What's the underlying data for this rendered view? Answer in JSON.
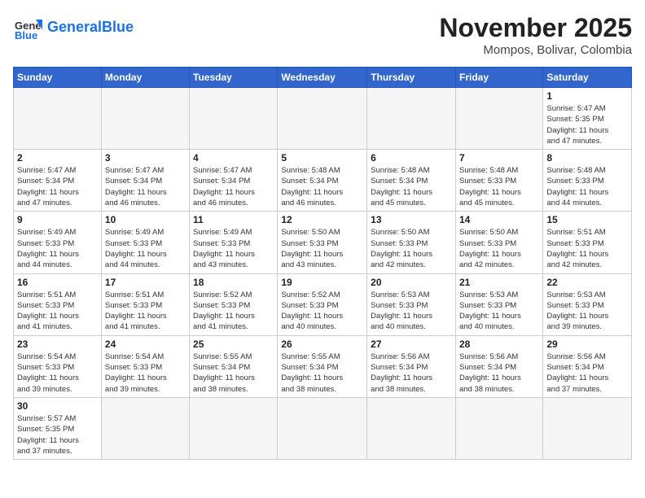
{
  "header": {
    "logo_text_general": "General",
    "logo_text_blue": "Blue",
    "month_year": "November 2025",
    "location": "Mompos, Bolivar, Colombia"
  },
  "weekdays": [
    "Sunday",
    "Monday",
    "Tuesday",
    "Wednesday",
    "Thursday",
    "Friday",
    "Saturday"
  ],
  "weeks": [
    [
      {
        "day": "",
        "info": ""
      },
      {
        "day": "",
        "info": ""
      },
      {
        "day": "",
        "info": ""
      },
      {
        "day": "",
        "info": ""
      },
      {
        "day": "",
        "info": ""
      },
      {
        "day": "",
        "info": ""
      },
      {
        "day": "1",
        "info": "Sunrise: 5:47 AM\nSunset: 5:35 PM\nDaylight: 11 hours\nand 47 minutes."
      }
    ],
    [
      {
        "day": "2",
        "info": "Sunrise: 5:47 AM\nSunset: 5:34 PM\nDaylight: 11 hours\nand 47 minutes."
      },
      {
        "day": "3",
        "info": "Sunrise: 5:47 AM\nSunset: 5:34 PM\nDaylight: 11 hours\nand 46 minutes."
      },
      {
        "day": "4",
        "info": "Sunrise: 5:47 AM\nSunset: 5:34 PM\nDaylight: 11 hours\nand 46 minutes."
      },
      {
        "day": "5",
        "info": "Sunrise: 5:48 AM\nSunset: 5:34 PM\nDaylight: 11 hours\nand 46 minutes."
      },
      {
        "day": "6",
        "info": "Sunrise: 5:48 AM\nSunset: 5:34 PM\nDaylight: 11 hours\nand 45 minutes."
      },
      {
        "day": "7",
        "info": "Sunrise: 5:48 AM\nSunset: 5:33 PM\nDaylight: 11 hours\nand 45 minutes."
      },
      {
        "day": "8",
        "info": "Sunrise: 5:48 AM\nSunset: 5:33 PM\nDaylight: 11 hours\nand 44 minutes."
      }
    ],
    [
      {
        "day": "9",
        "info": "Sunrise: 5:49 AM\nSunset: 5:33 PM\nDaylight: 11 hours\nand 44 minutes."
      },
      {
        "day": "10",
        "info": "Sunrise: 5:49 AM\nSunset: 5:33 PM\nDaylight: 11 hours\nand 44 minutes."
      },
      {
        "day": "11",
        "info": "Sunrise: 5:49 AM\nSunset: 5:33 PM\nDaylight: 11 hours\nand 43 minutes."
      },
      {
        "day": "12",
        "info": "Sunrise: 5:50 AM\nSunset: 5:33 PM\nDaylight: 11 hours\nand 43 minutes."
      },
      {
        "day": "13",
        "info": "Sunrise: 5:50 AM\nSunset: 5:33 PM\nDaylight: 11 hours\nand 42 minutes."
      },
      {
        "day": "14",
        "info": "Sunrise: 5:50 AM\nSunset: 5:33 PM\nDaylight: 11 hours\nand 42 minutes."
      },
      {
        "day": "15",
        "info": "Sunrise: 5:51 AM\nSunset: 5:33 PM\nDaylight: 11 hours\nand 42 minutes."
      }
    ],
    [
      {
        "day": "16",
        "info": "Sunrise: 5:51 AM\nSunset: 5:33 PM\nDaylight: 11 hours\nand 41 minutes."
      },
      {
        "day": "17",
        "info": "Sunrise: 5:51 AM\nSunset: 5:33 PM\nDaylight: 11 hours\nand 41 minutes."
      },
      {
        "day": "18",
        "info": "Sunrise: 5:52 AM\nSunset: 5:33 PM\nDaylight: 11 hours\nand 41 minutes."
      },
      {
        "day": "19",
        "info": "Sunrise: 5:52 AM\nSunset: 5:33 PM\nDaylight: 11 hours\nand 40 minutes."
      },
      {
        "day": "20",
        "info": "Sunrise: 5:53 AM\nSunset: 5:33 PM\nDaylight: 11 hours\nand 40 minutes."
      },
      {
        "day": "21",
        "info": "Sunrise: 5:53 AM\nSunset: 5:33 PM\nDaylight: 11 hours\nand 40 minutes."
      },
      {
        "day": "22",
        "info": "Sunrise: 5:53 AM\nSunset: 5:33 PM\nDaylight: 11 hours\nand 39 minutes."
      }
    ],
    [
      {
        "day": "23",
        "info": "Sunrise: 5:54 AM\nSunset: 5:33 PM\nDaylight: 11 hours\nand 39 minutes."
      },
      {
        "day": "24",
        "info": "Sunrise: 5:54 AM\nSunset: 5:33 PM\nDaylight: 11 hours\nand 39 minutes."
      },
      {
        "day": "25",
        "info": "Sunrise: 5:55 AM\nSunset: 5:34 PM\nDaylight: 11 hours\nand 38 minutes."
      },
      {
        "day": "26",
        "info": "Sunrise: 5:55 AM\nSunset: 5:34 PM\nDaylight: 11 hours\nand 38 minutes."
      },
      {
        "day": "27",
        "info": "Sunrise: 5:56 AM\nSunset: 5:34 PM\nDaylight: 11 hours\nand 38 minutes."
      },
      {
        "day": "28",
        "info": "Sunrise: 5:56 AM\nSunset: 5:34 PM\nDaylight: 11 hours\nand 38 minutes."
      },
      {
        "day": "29",
        "info": "Sunrise: 5:56 AM\nSunset: 5:34 PM\nDaylight: 11 hours\nand 37 minutes."
      }
    ],
    [
      {
        "day": "30",
        "info": "Sunrise: 5:57 AM\nSunset: 5:35 PM\nDaylight: 11 hours\nand 37 minutes."
      },
      {
        "day": "",
        "info": ""
      },
      {
        "day": "",
        "info": ""
      },
      {
        "day": "",
        "info": ""
      },
      {
        "day": "",
        "info": ""
      },
      {
        "day": "",
        "info": ""
      },
      {
        "day": "",
        "info": ""
      }
    ]
  ]
}
